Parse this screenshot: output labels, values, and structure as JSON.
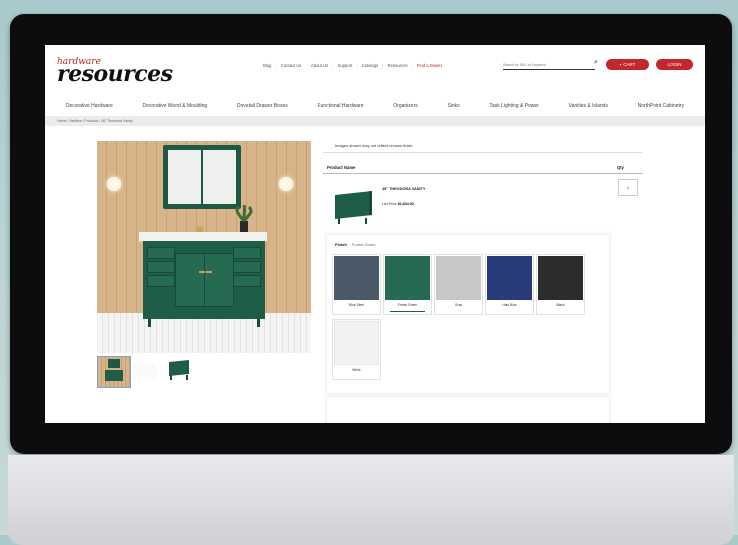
{
  "header": {
    "logo_top": "hardware",
    "logo_main": "resources",
    "top_links": [
      "Blog",
      "·",
      "Contact Us",
      "·",
      "About Us",
      "·",
      "Support",
      "·",
      "Catalogs",
      "·",
      "Resources",
      "·"
    ],
    "dealer_link": "Find a Dealer",
    "search_placeholder": "Search by SKU or Keyword",
    "cart_label": "CART",
    "login_label": "LOGIN"
  },
  "nav": {
    "items": [
      "Decorative Hardware",
      "Decorative Wood & Moulding",
      "Dovetail Drawer Boxes",
      "Functional Hardware",
      "Organizers",
      "Sinks",
      "Task Lighting & Power",
      "Vanities & Islands",
      "NorthPoint Cabinetry"
    ]
  },
  "breadcrumb": "Home / Vanities / Products / 48\" Theodora Vanity",
  "product": {
    "notice": "Images shown may not reflect chosen finish",
    "table_header_name": "Product Name",
    "table_header_qty": "Qty",
    "name": "48\" THEODORA VANITY",
    "price_label": "List Price",
    "price": "$2,844.00",
    "qty": "1"
  },
  "finish": {
    "label": "Finish",
    "selected": "Forest Green",
    "options": [
      {
        "label": "Blue Steel",
        "color": "#4a5867"
      },
      {
        "label": "Forest Green",
        "color": "#256a51"
      },
      {
        "label": "Gray",
        "color": "#c6c8c8"
      },
      {
        "label": "Hale Blue",
        "color": "#283a78"
      },
      {
        "label": "Black",
        "color": "#2b2c2e"
      },
      {
        "label": "White",
        "color": "#f2f2f0"
      }
    ]
  }
}
